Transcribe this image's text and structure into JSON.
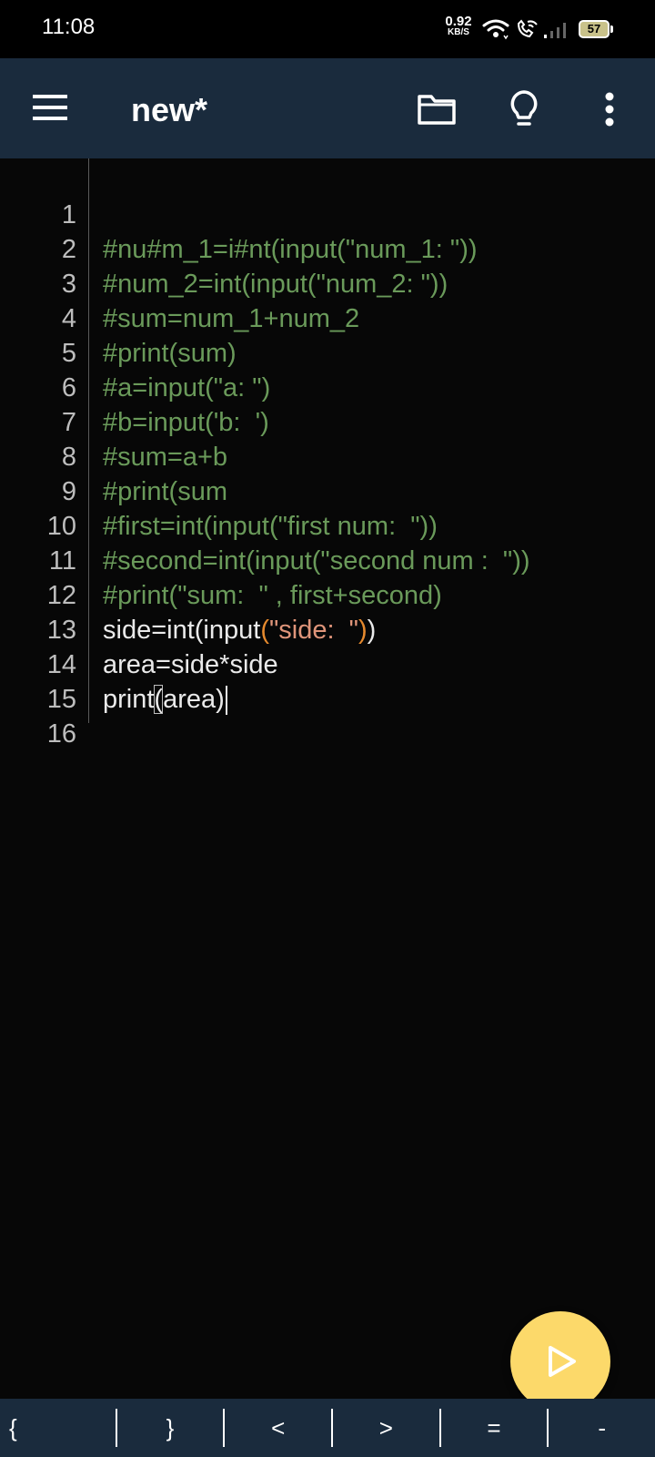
{
  "status": {
    "time": "11:08",
    "net_speed_value": "0.92",
    "net_speed_unit": "KB/S",
    "battery": "57",
    "icons": [
      "wifi-icon",
      "wifi-call-icon",
      "signal-icon",
      "battery-icon"
    ]
  },
  "toolbar": {
    "title": "new*",
    "icons": [
      "menu-icon",
      "folder-icon",
      "lightbulb-icon",
      "more-vert-icon"
    ]
  },
  "editor": {
    "lines": [
      {
        "n": "1",
        "text": "#nu#m_1=i#nt(input(\"num_1: \"))"
      },
      {
        "n": "2",
        "text": "#num_2=int(input(\"num_2: \"))"
      },
      {
        "n": "3",
        "text": "#sum=num_1+num_2"
      },
      {
        "n": "4",
        "text": "#print(sum)"
      },
      {
        "n": "5",
        "text": "#a=input(\"a: \")"
      },
      {
        "n": "6",
        "text": "#b=input('b:  ')"
      },
      {
        "n": "7",
        "text": "#sum=a+b"
      },
      {
        "n": "8",
        "text": "#print(sum"
      },
      {
        "n": "9",
        "text": "#first=int(input(\"first num:  \"))"
      },
      {
        "n": "10",
        "text": "#second=int(input(\"second num :  \"))"
      },
      {
        "n": "11",
        "text": "#print(\"sum:  \" , first+second)"
      },
      {
        "n": "12",
        "parts": [
          "side=int(input",
          "(",
          "\"side:  \"",
          ")",
          ")"
        ]
      },
      {
        "n": "13",
        "text": "area=side*side"
      },
      {
        "n": "14",
        "parts": [
          "print",
          "(",
          "area)"
        ]
      },
      {
        "n": "15",
        "text": ""
      },
      {
        "n": "16",
        "text": ""
      }
    ]
  },
  "fab": {
    "icon": "play-icon",
    "color": "#fcd96a"
  },
  "symbols": [
    "{",
    "}",
    "<",
    ">",
    "=",
    "-"
  ],
  "colors": {
    "toolbar_bg": "#1a2b3d",
    "editor_bg": "#070707",
    "comment": "#6a9a5a",
    "code": "#eaeaea",
    "string": "#e0957a",
    "paren_match": "#e68a2e",
    "accent": "#fcd96a"
  }
}
